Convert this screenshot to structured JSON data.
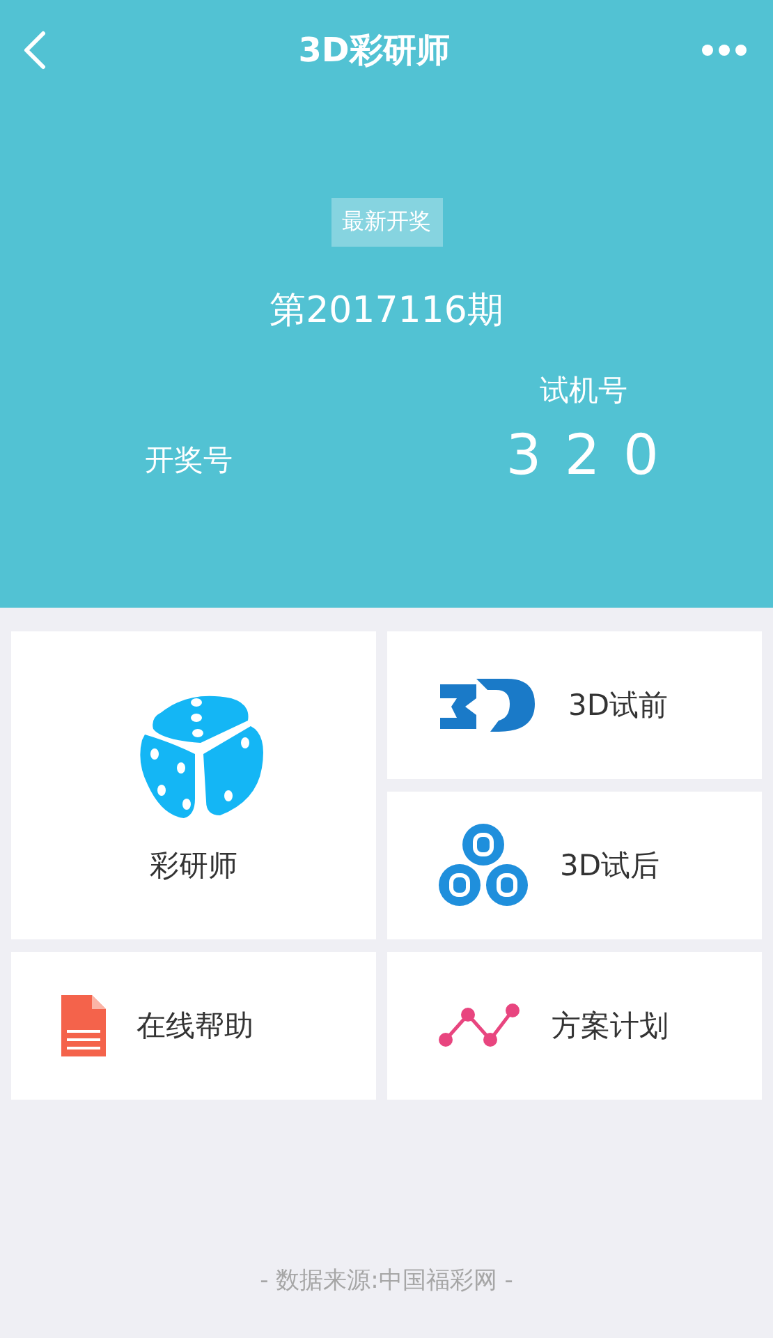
{
  "nav": {
    "title": "3D彩研师"
  },
  "draw": {
    "badge": "最新开奖",
    "period": "第2017116期",
    "trial_label": "试机号",
    "trial_number": "3 2 0",
    "draw_label": "开奖号"
  },
  "tiles": [
    {
      "kind": "row",
      "label": "3D试前"
    },
    {
      "kind": "big",
      "label": "彩研师"
    },
    {
      "kind": "row",
      "label": "3D试后"
    },
    {
      "kind": "row",
      "label": "在线帮助"
    },
    {
      "kind": "row",
      "label": "方案计划"
    }
  ],
  "footer": "- 数据来源:中国福彩网 -"
}
